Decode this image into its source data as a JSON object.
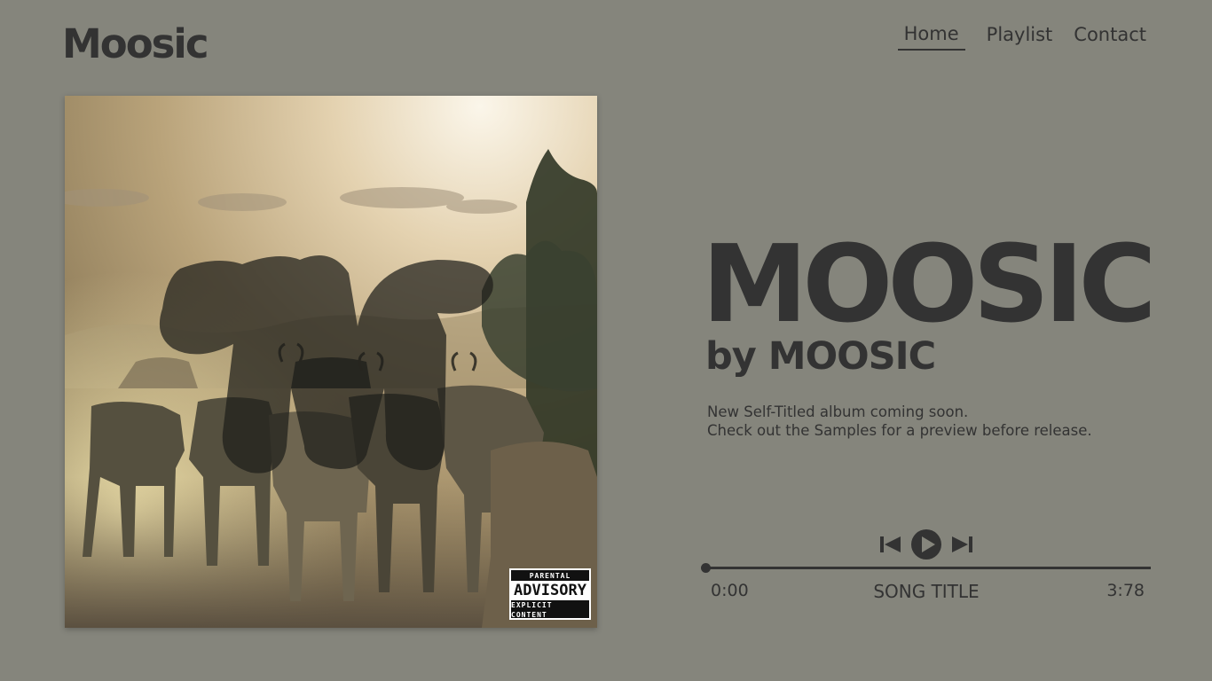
{
  "site": {
    "logo_text": "Moosic"
  },
  "nav": {
    "items": [
      {
        "label": "Home",
        "active": true
      },
      {
        "label": "Playlist",
        "active": false
      },
      {
        "label": "Contact",
        "active": false
      }
    ]
  },
  "cover": {
    "image": "album-cover-cattle-herd-sunrise",
    "advisory": {
      "top": "PARENTAL",
      "middle": "ADVISORY",
      "bottom": "EXPLICIT CONTENT"
    }
  },
  "album": {
    "title": "MOOSIC",
    "artist_line": "by MOOSIC",
    "description": [
      "New Self-Titled album coming soon.",
      "Check out the Samples for a preview before release."
    ]
  },
  "player": {
    "prev_icon": "skip-previous-icon",
    "play_icon": "play-icon",
    "next_icon": "skip-next-icon",
    "progress_fraction": 0,
    "time_current": "0:00",
    "song_title": "SONG TITLE",
    "time_total": "3:78"
  },
  "colors": {
    "background": "#85857c",
    "text": "#333333"
  }
}
